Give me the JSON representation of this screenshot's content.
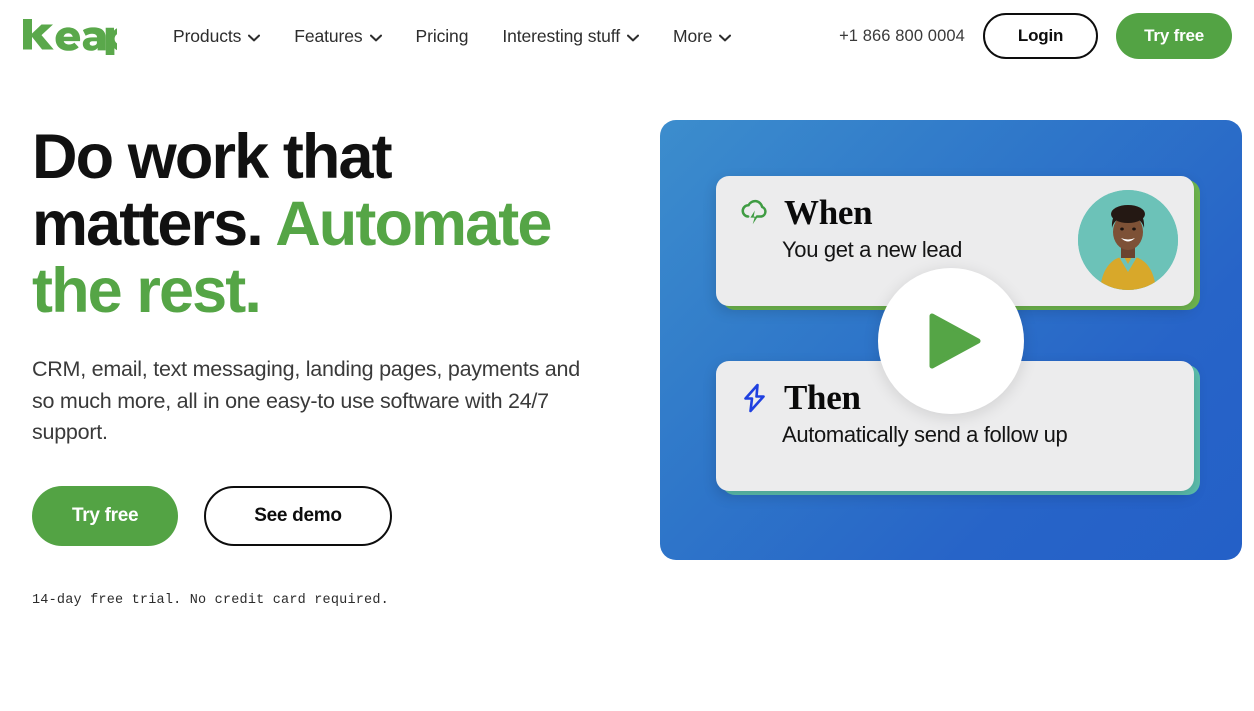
{
  "brand": {
    "logo_text": "keap",
    "green": "#53a344",
    "accent_green_light": "#6fb84f",
    "accent_teal": "#5cbfae",
    "panel_blue_light": "#3c8dcd",
    "panel_blue_dark": "#2460c7",
    "logo_icon": "keap-wordmark"
  },
  "nav": {
    "items": [
      {
        "label": "Products",
        "has_chevron": true,
        "icon": "chevron-down-icon"
      },
      {
        "label": "Features",
        "has_chevron": true,
        "icon": "chevron-down-icon"
      },
      {
        "label": "Pricing",
        "has_chevron": false,
        "icon": ""
      },
      {
        "label": "Interesting stuff",
        "has_chevron": true,
        "icon": "chevron-down-icon"
      },
      {
        "label": "More",
        "has_chevron": true,
        "icon": "chevron-down-icon"
      }
    ],
    "phone": "+1 866 800 0004",
    "login_label": "Login",
    "try_free_label": "Try free"
  },
  "hero": {
    "headline_part1": "Do work that matters. ",
    "headline_part2": "Automate the rest.",
    "subcopy": "CRM, email, text messaging, landing pages, payments and so much more, all in one easy-to use software with 24/7 support.",
    "primary_cta": "Try free",
    "secondary_cta": "See demo",
    "fineprint": "14-day free trial. No credit card required."
  },
  "media": {
    "play_label": "play-icon",
    "cards": [
      {
        "title": "When",
        "subtitle": "You get a new lead",
        "icon": "cloud-lightning-icon",
        "icon_color": "#3f9c43",
        "accent_color": "#6fb84f",
        "avatar": "avatar-smiling-woman"
      },
      {
        "title": "Then",
        "subtitle": "Automatically send a follow up",
        "icon": "lightning-bolt-icon",
        "icon_color": "#1f40e0",
        "accent_color": "#5cbfae",
        "avatar": ""
      }
    ]
  }
}
